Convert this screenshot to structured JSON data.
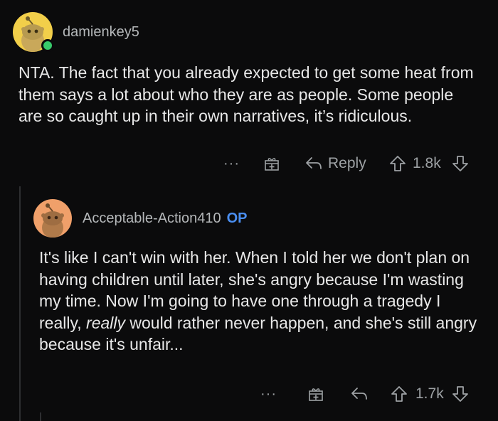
{
  "comment": {
    "username": "damienkey5",
    "body": "NTA. The fact that you already expected to get some heat from them says a lot about who they are as people. Some people are so caught up in their own narratives, it’s ridiculous.",
    "reply_label": "Reply",
    "score": "1.8k",
    "more_label": "···"
  },
  "reply": {
    "username": "Acceptable-Action410",
    "badge": "OP",
    "body_before": "It's like I can't win with her. When I told her we don't plan on having children until later, she's angry because I'm wasting my time. Now I'm going to have one through a tragedy I really, ",
    "body_emphasis": "really",
    "body_after": " would rather never happen, and she's still angry because it's unfair...",
    "score": "1.7k",
    "more_label": "···"
  },
  "colors": {
    "background": "#0b0b0c",
    "text": "#e8e8e8",
    "meta": "#9ea2a5",
    "op_badge": "#4a8ef0",
    "online": "#38c96b",
    "avatar1": "#f2cf4a",
    "avatar2": "#f0a06a"
  }
}
